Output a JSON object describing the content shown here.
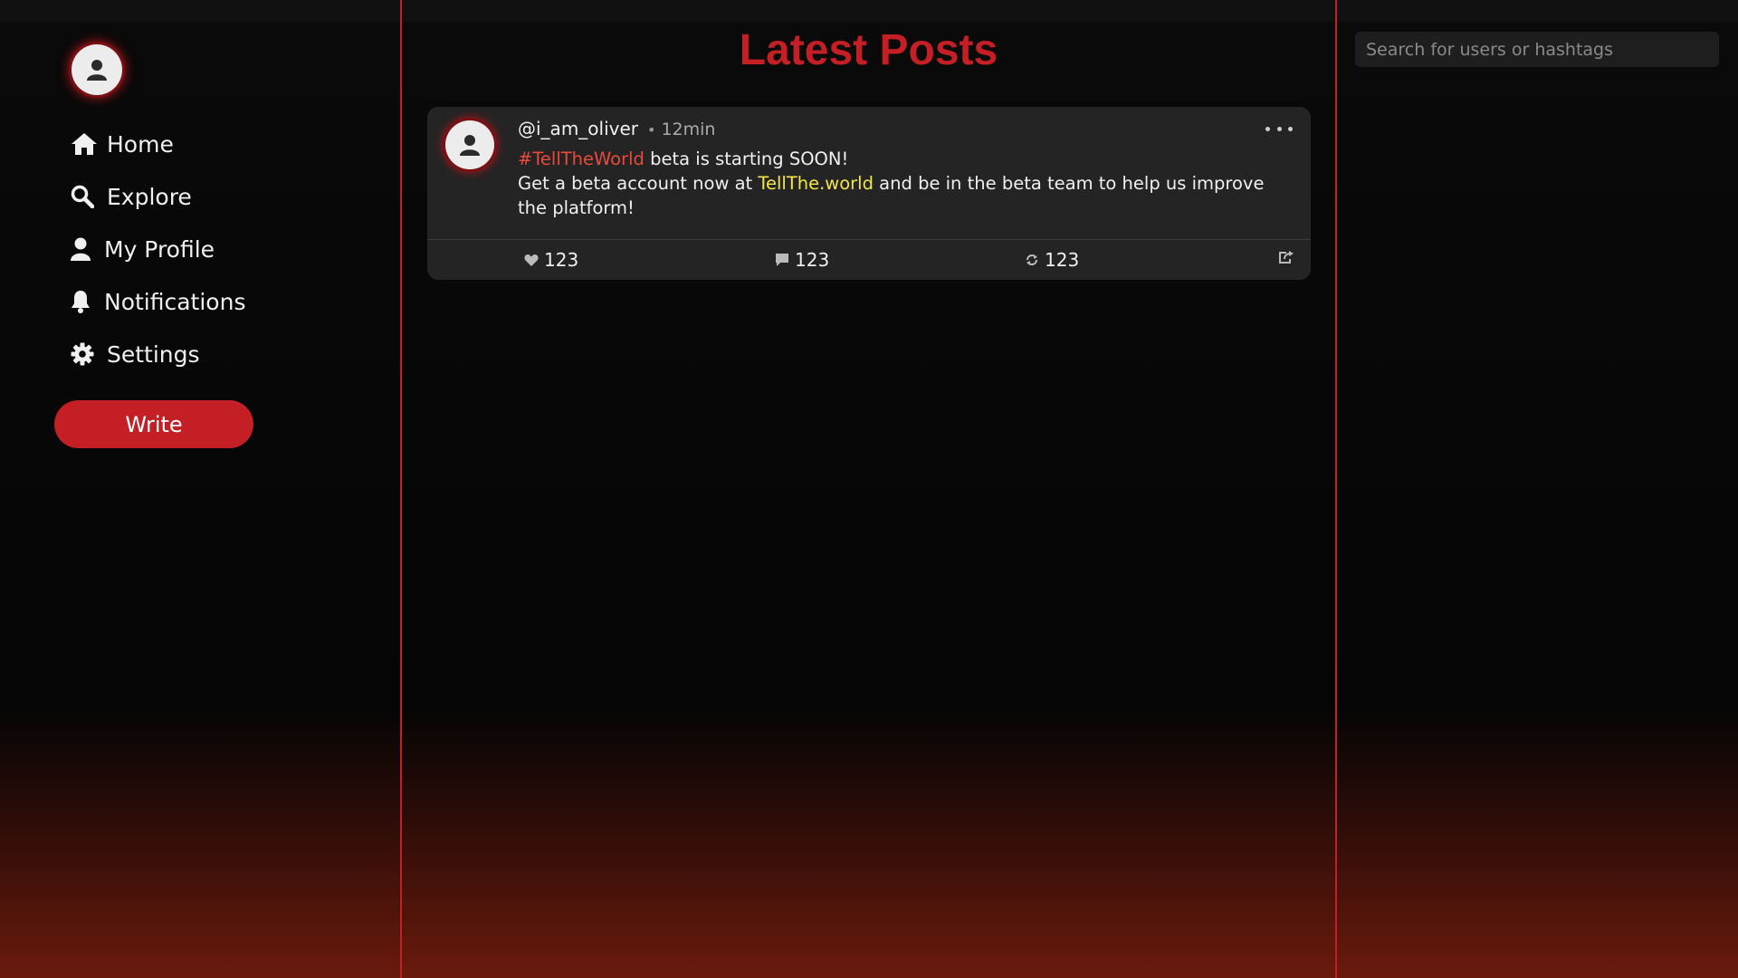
{
  "sidebar": {
    "avatar_icon": "user-icon",
    "items": [
      {
        "label": "Home",
        "icon": "home-icon"
      },
      {
        "label": "Explore",
        "icon": "search-icon"
      },
      {
        "label": "My Profile",
        "icon": "user-icon"
      },
      {
        "label": "Notifications",
        "icon": "bell-icon"
      },
      {
        "label": "Settings",
        "icon": "gear-icon"
      }
    ],
    "write_label": "Write"
  },
  "main": {
    "title": "Latest Posts",
    "post": {
      "username": "@i_am_oliver",
      "dot": "•",
      "time": "12min",
      "hashtag": "#TellTheWorld",
      "line1_rest": " beta is starting SOON!",
      "line2_pre": "Get a beta account now at ",
      "link": "TellThe.world",
      "line2_post": " and be in the beta team to help us improve the platform!",
      "likes": "123",
      "comments": "123",
      "reposts": "123"
    }
  },
  "search": {
    "placeholder": "Search for users or hashtags"
  },
  "colors": {
    "accent": "#c41f24",
    "hashtag": "#e84a3c",
    "link": "#f2e64a",
    "card": "#242424"
  }
}
